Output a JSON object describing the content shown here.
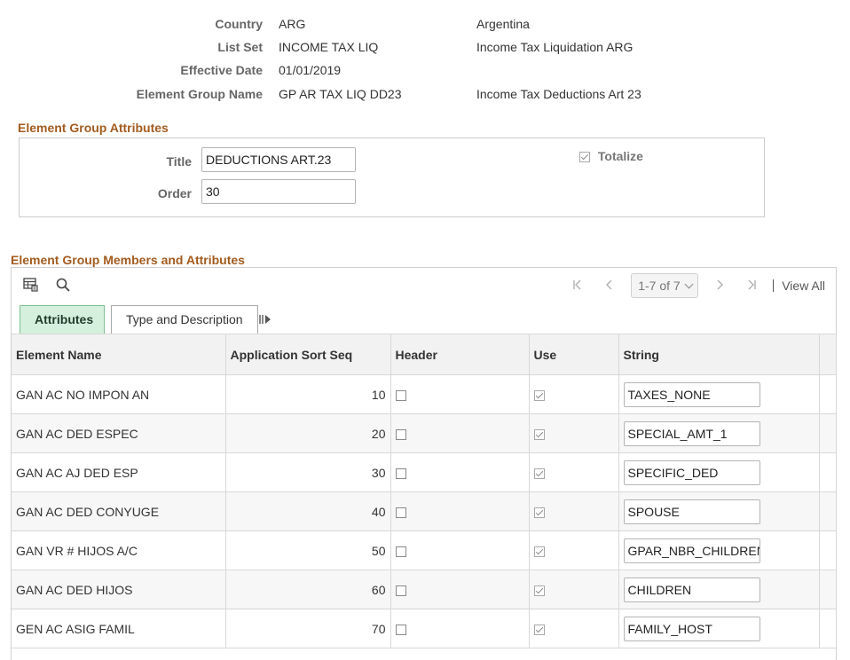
{
  "header": {
    "rows": [
      {
        "label": "Country",
        "value": "ARG",
        "description": "Argentina"
      },
      {
        "label": "List Set",
        "value": "INCOME TAX LIQ",
        "description": "Income Tax Liquidation ARG"
      },
      {
        "label": "Effective Date",
        "value": "01/01/2019",
        "description": ""
      },
      {
        "label": "Element Group Name",
        "value": "GP AR TAX LIQ DD23",
        "description": "Income Tax Deductions Art 23"
      }
    ]
  },
  "attributes_section": {
    "title": "Element Group Attributes",
    "title_label": "Title",
    "title_value": "DEDUCTIONS ART.23",
    "order_label": "Order",
    "order_value": "30",
    "totalize_label": "Totalize",
    "totalize_checked": true
  },
  "members_section": {
    "title": "Element Group Members and Attributes",
    "pager": {
      "range": "1-7 of 7",
      "view_all": "View All"
    },
    "tabs": [
      {
        "label": "Attributes",
        "active": true
      },
      {
        "label": "Type and Description",
        "active": false
      }
    ],
    "columns": [
      "Element Name",
      "Application Sort Seq",
      "Header",
      "Use",
      "String"
    ],
    "rows": [
      {
        "element": "GAN AC NO IMPON AN",
        "seq": "10",
        "header": false,
        "use": true,
        "string": "TAXES_NONE"
      },
      {
        "element": "GAN AC DED ESPEC",
        "seq": "20",
        "header": false,
        "use": true,
        "string": "SPECIAL_AMT_1"
      },
      {
        "element": "GAN AC AJ DED ESP",
        "seq": "30",
        "header": false,
        "use": true,
        "string": "SPECIFIC_DED"
      },
      {
        "element": "GAN AC DED CONYUGE",
        "seq": "40",
        "header": false,
        "use": true,
        "string": "SPOUSE"
      },
      {
        "element": "GAN VR # HIJOS A/C",
        "seq": "50",
        "header": false,
        "use": true,
        "string": "GPAR_NBR_CHILDREN"
      },
      {
        "element": "GAN AC DED HIJOS",
        "seq": "60",
        "header": false,
        "use": true,
        "string": "CHILDREN"
      },
      {
        "element": "GEN AC ASIG FAMIL",
        "seq": "70",
        "header": false,
        "use": true,
        "string": "FAMILY_HOST"
      }
    ]
  },
  "icons": {
    "personalize": "grid-personalize-icon",
    "find": "search-icon",
    "first": "first-page-icon",
    "previous": "previous-page-icon",
    "next": "next-page-icon",
    "last": "last-page-icon",
    "show_all_columns": "show-all-columns-icon"
  },
  "colors": {
    "section_title": "#a35b1f",
    "active_tab_bg": "#d6f0de",
    "active_tab_border": "#7fbf94"
  }
}
